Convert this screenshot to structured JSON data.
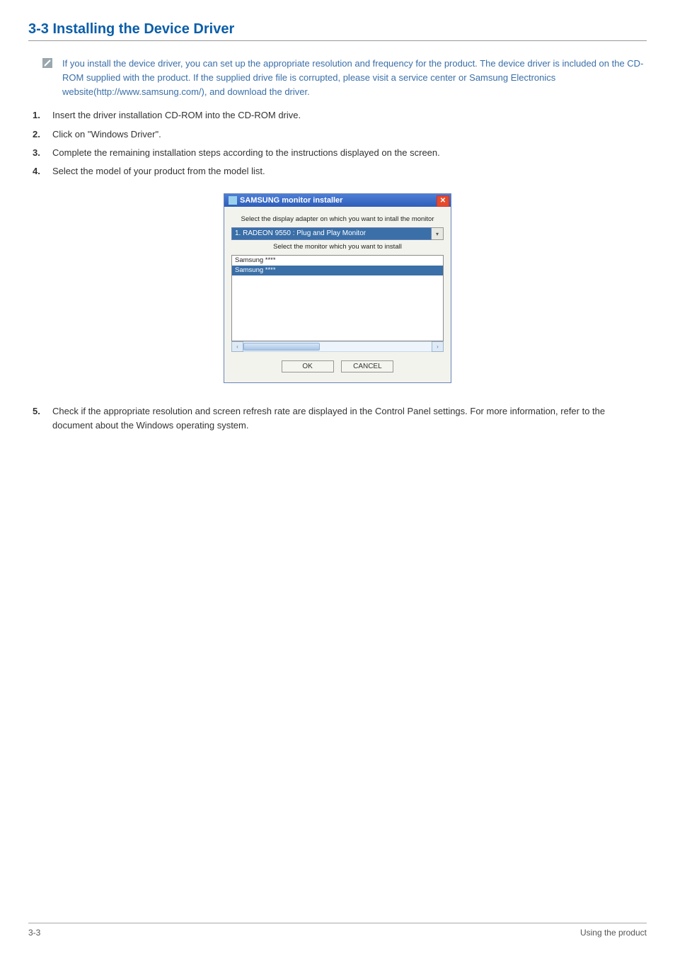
{
  "heading": "3-3    Installing the Device Driver",
  "note": "If you install the device driver, you can set up the appropriate resolution and frequency for the product. The device driver is included on the CD-ROM supplied with the product. If the supplied drive file is corrupted, please visit a service center or Samsung Electronics website(http://www.samsung.com/), and download the driver.",
  "steps": [
    "Insert the driver installation CD-ROM into the CD-ROM drive.",
    "Click on \"Windows Driver\".",
    "Complete the remaining installation steps according to the instructions displayed on the screen.",
    "Select the model of your product from the model list."
  ],
  "dialog": {
    "title": "SAMSUNG monitor installer",
    "label_adapter": "Select the display adapter on which you want to intall the monitor",
    "combo_value": "1. RADEON 9550 : Plug and Play Monitor",
    "label_monitor": "Select the monitor which you want to install",
    "list": [
      {
        "text": "Samsung ****",
        "selected": false
      },
      {
        "text": "Samsung ****",
        "selected": true
      }
    ],
    "ok": "OK",
    "cancel": "CANCEL"
  },
  "step5": "Check if the appropriate resolution and screen refresh rate are displayed in the Control Panel settings. For more information, refer to the document about the Windows operating system.",
  "footer": {
    "left": "3-3",
    "right": "Using the product"
  }
}
